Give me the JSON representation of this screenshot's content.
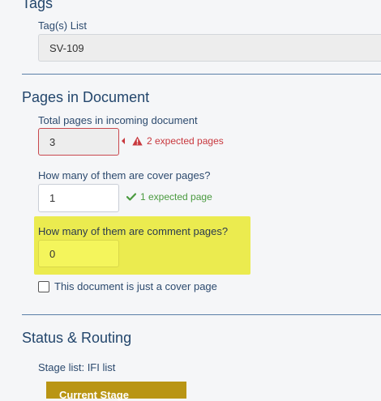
{
  "tags": {
    "section_title": "Tags",
    "list_label": "Tag(s) List",
    "list_value": "SV-109"
  },
  "pages": {
    "section_title": "Pages in Document",
    "total_label": "Total pages in incoming document",
    "total_value": "3",
    "total_error": "2 expected pages",
    "cover_label": "How many of them are cover pages?",
    "cover_value": "1",
    "cover_ok": "1 expected page",
    "comment_label": "How many of them are comment pages?",
    "comment_value": "0",
    "cover_only_label": "This document is just a cover page"
  },
  "status": {
    "section_title": "Status & Routing",
    "stage_list_label": "Stage list: IFI list",
    "current_stage": "Current Stage"
  },
  "colors": {
    "error": "#c8383e",
    "ok": "#4a9a3f",
    "highlight": "#ebeb4f",
    "stage": "#b99514"
  },
  "icons": {
    "error": "warning-icon",
    "ok": "check-icon",
    "pointer": "caret-left-icon"
  }
}
